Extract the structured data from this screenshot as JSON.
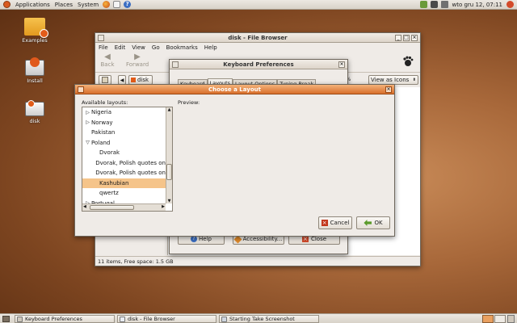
{
  "top_panel": {
    "menus": [
      "Applications",
      "Places",
      "System"
    ],
    "clock": "wto gru 12, 07:11"
  },
  "desktop_icons": [
    {
      "label": "Examples"
    },
    {
      "label": "Install"
    },
    {
      "label": "disk"
    }
  ],
  "file_browser": {
    "title": "disk - File Browser",
    "menus": [
      "File",
      "Edit",
      "View",
      "Go",
      "Bookmarks",
      "Help"
    ],
    "toolbar": {
      "back": "Back",
      "forward": "Forward"
    },
    "location": "disk",
    "view_as": "View as Icons",
    "zoom": "%",
    "status": "11 items, Free space: 1.5 GB"
  },
  "keyboard_prefs": {
    "title": "Keyboard Preferences",
    "tabs": [
      "Keyboard",
      "Layouts",
      "Layout Options",
      "Typing Break"
    ],
    "buttons": {
      "help": "Help",
      "accessibility": "Accessibility...",
      "close": "Close"
    }
  },
  "choose_layout": {
    "title": "Choose a Layout",
    "available_label": "Available layouts:",
    "preview_label": "Preview:",
    "layouts": [
      {
        "label": "Nigeria",
        "kind": "collapsed"
      },
      {
        "label": "Norway",
        "kind": "collapsed"
      },
      {
        "label": "Pakistan",
        "kind": "leaf"
      },
      {
        "label": "Poland",
        "kind": "expanded"
      },
      {
        "label": "Dvorak",
        "kind": "child"
      },
      {
        "label": "Dvorak, Polish quotes on",
        "kind": "child"
      },
      {
        "label": "Dvorak, Polish quotes on",
        "kind": "child"
      },
      {
        "label": "Kashubian",
        "kind": "child-selected"
      },
      {
        "label": "qwertz",
        "kind": "child"
      },
      {
        "label": "Portugal",
        "kind": "collapsed"
      }
    ],
    "cancel": "Cancel",
    "ok": "OK"
  },
  "taskbar": [
    {
      "label": "Keyboard Preferences"
    },
    {
      "label": "disk - File Browser"
    },
    {
      "label": "Starting Take Screenshot"
    }
  ],
  "colors": {
    "accent": "#d86f2b",
    "selection": "#f5c48a",
    "ubuntu": "#d95a1e"
  }
}
